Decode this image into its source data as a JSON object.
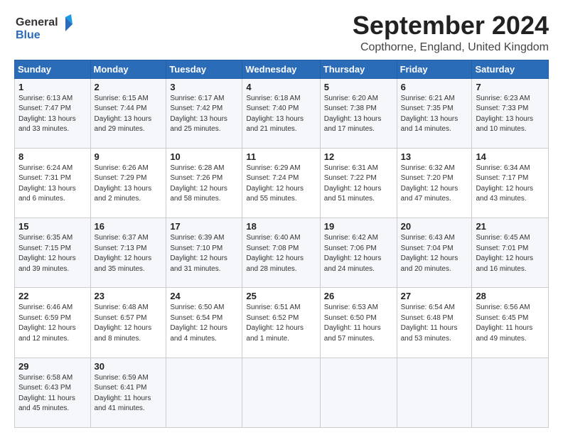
{
  "logo": {
    "line1": "General",
    "line2": "Blue"
  },
  "title": "September 2024",
  "subtitle": "Copthorne, England, United Kingdom",
  "days_header": [
    "Sunday",
    "Monday",
    "Tuesday",
    "Wednesday",
    "Thursday",
    "Friday",
    "Saturday"
  ],
  "weeks": [
    [
      {
        "num": "1",
        "detail": "Sunrise: 6:13 AM\nSunset: 7:47 PM\nDaylight: 13 hours\nand 33 minutes."
      },
      {
        "num": "2",
        "detail": "Sunrise: 6:15 AM\nSunset: 7:44 PM\nDaylight: 13 hours\nand 29 minutes."
      },
      {
        "num": "3",
        "detail": "Sunrise: 6:17 AM\nSunset: 7:42 PM\nDaylight: 13 hours\nand 25 minutes."
      },
      {
        "num": "4",
        "detail": "Sunrise: 6:18 AM\nSunset: 7:40 PM\nDaylight: 13 hours\nand 21 minutes."
      },
      {
        "num": "5",
        "detail": "Sunrise: 6:20 AM\nSunset: 7:38 PM\nDaylight: 13 hours\nand 17 minutes."
      },
      {
        "num": "6",
        "detail": "Sunrise: 6:21 AM\nSunset: 7:35 PM\nDaylight: 13 hours\nand 14 minutes."
      },
      {
        "num": "7",
        "detail": "Sunrise: 6:23 AM\nSunset: 7:33 PM\nDaylight: 13 hours\nand 10 minutes."
      }
    ],
    [
      {
        "num": "8",
        "detail": "Sunrise: 6:24 AM\nSunset: 7:31 PM\nDaylight: 13 hours\nand 6 minutes."
      },
      {
        "num": "9",
        "detail": "Sunrise: 6:26 AM\nSunset: 7:29 PM\nDaylight: 13 hours\nand 2 minutes."
      },
      {
        "num": "10",
        "detail": "Sunrise: 6:28 AM\nSunset: 7:26 PM\nDaylight: 12 hours\nand 58 minutes."
      },
      {
        "num": "11",
        "detail": "Sunrise: 6:29 AM\nSunset: 7:24 PM\nDaylight: 12 hours\nand 55 minutes."
      },
      {
        "num": "12",
        "detail": "Sunrise: 6:31 AM\nSunset: 7:22 PM\nDaylight: 12 hours\nand 51 minutes."
      },
      {
        "num": "13",
        "detail": "Sunrise: 6:32 AM\nSunset: 7:20 PM\nDaylight: 12 hours\nand 47 minutes."
      },
      {
        "num": "14",
        "detail": "Sunrise: 6:34 AM\nSunset: 7:17 PM\nDaylight: 12 hours\nand 43 minutes."
      }
    ],
    [
      {
        "num": "15",
        "detail": "Sunrise: 6:35 AM\nSunset: 7:15 PM\nDaylight: 12 hours\nand 39 minutes."
      },
      {
        "num": "16",
        "detail": "Sunrise: 6:37 AM\nSunset: 7:13 PM\nDaylight: 12 hours\nand 35 minutes."
      },
      {
        "num": "17",
        "detail": "Sunrise: 6:39 AM\nSunset: 7:10 PM\nDaylight: 12 hours\nand 31 minutes."
      },
      {
        "num": "18",
        "detail": "Sunrise: 6:40 AM\nSunset: 7:08 PM\nDaylight: 12 hours\nand 28 minutes."
      },
      {
        "num": "19",
        "detail": "Sunrise: 6:42 AM\nSunset: 7:06 PM\nDaylight: 12 hours\nand 24 minutes."
      },
      {
        "num": "20",
        "detail": "Sunrise: 6:43 AM\nSunset: 7:04 PM\nDaylight: 12 hours\nand 20 minutes."
      },
      {
        "num": "21",
        "detail": "Sunrise: 6:45 AM\nSunset: 7:01 PM\nDaylight: 12 hours\nand 16 minutes."
      }
    ],
    [
      {
        "num": "22",
        "detail": "Sunrise: 6:46 AM\nSunset: 6:59 PM\nDaylight: 12 hours\nand 12 minutes."
      },
      {
        "num": "23",
        "detail": "Sunrise: 6:48 AM\nSunset: 6:57 PM\nDaylight: 12 hours\nand 8 minutes."
      },
      {
        "num": "24",
        "detail": "Sunrise: 6:50 AM\nSunset: 6:54 PM\nDaylight: 12 hours\nand 4 minutes."
      },
      {
        "num": "25",
        "detail": "Sunrise: 6:51 AM\nSunset: 6:52 PM\nDaylight: 12 hours\nand 1 minute."
      },
      {
        "num": "26",
        "detail": "Sunrise: 6:53 AM\nSunset: 6:50 PM\nDaylight: 11 hours\nand 57 minutes."
      },
      {
        "num": "27",
        "detail": "Sunrise: 6:54 AM\nSunset: 6:48 PM\nDaylight: 11 hours\nand 53 minutes."
      },
      {
        "num": "28",
        "detail": "Sunrise: 6:56 AM\nSunset: 6:45 PM\nDaylight: 11 hours\nand 49 minutes."
      }
    ],
    [
      {
        "num": "29",
        "detail": "Sunrise: 6:58 AM\nSunset: 6:43 PM\nDaylight: 11 hours\nand 45 minutes."
      },
      {
        "num": "30",
        "detail": "Sunrise: 6:59 AM\nSunset: 6:41 PM\nDaylight: 11 hours\nand 41 minutes."
      },
      {
        "num": "",
        "detail": ""
      },
      {
        "num": "",
        "detail": ""
      },
      {
        "num": "",
        "detail": ""
      },
      {
        "num": "",
        "detail": ""
      },
      {
        "num": "",
        "detail": ""
      }
    ]
  ]
}
